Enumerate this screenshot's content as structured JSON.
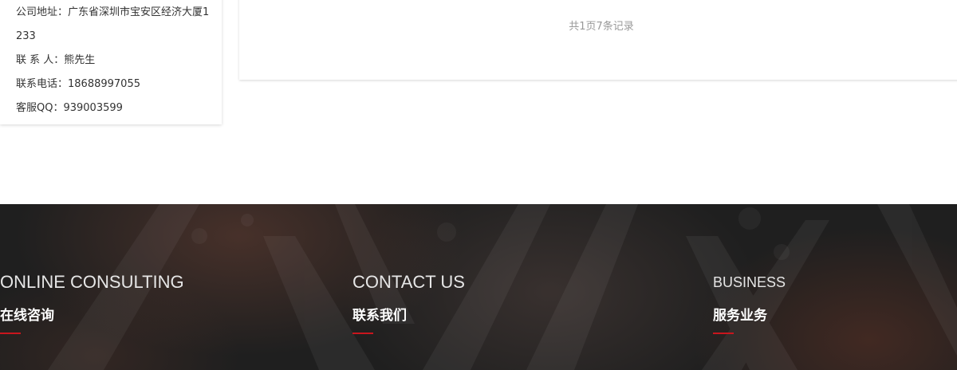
{
  "contact": {
    "address": "公司地址：广东省深圳市宝安区经济大厦1233",
    "person": "联 系 人：熊先生",
    "phone": "联系电话：18688997055",
    "qq": "客服QQ：939003599"
  },
  "pagination": {
    "summary": "共1页7条记录"
  },
  "footer": {
    "columns": [
      {
        "en": "ONLINE CONSULTING",
        "cn": "在线咨询"
      },
      {
        "en": "CONTACT US",
        "cn": "联系我们"
      },
      {
        "en": "BUSINESS",
        "cn": "服务业务"
      }
    ],
    "accent_color": "#c8161d",
    "background_color": "#1f1f1f"
  }
}
